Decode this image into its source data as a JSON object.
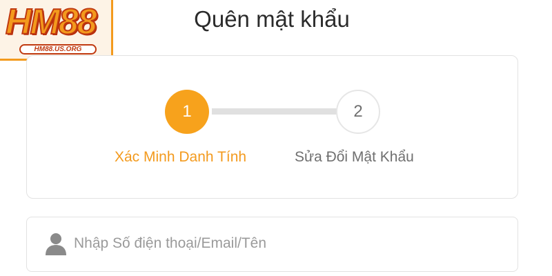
{
  "logo": {
    "text": "HM88",
    "subtext": "HM88.US.ORG"
  },
  "page": {
    "title": "Quên mật khẩu"
  },
  "steps": [
    {
      "number": "1",
      "label": "Xác Minh Danh Tính",
      "state": "active"
    },
    {
      "number": "2",
      "label": "Sửa Đổi Mật Khẩu",
      "state": "inactive"
    }
  ],
  "form": {
    "account_input": {
      "placeholder": "Nhập Số điện thoại/Email/Tên",
      "value": "",
      "icon": "user-icon"
    }
  },
  "colors": {
    "accent": "#f7a21c",
    "inactive_text": "#6f6f6f",
    "border": "#e2e2e2"
  }
}
